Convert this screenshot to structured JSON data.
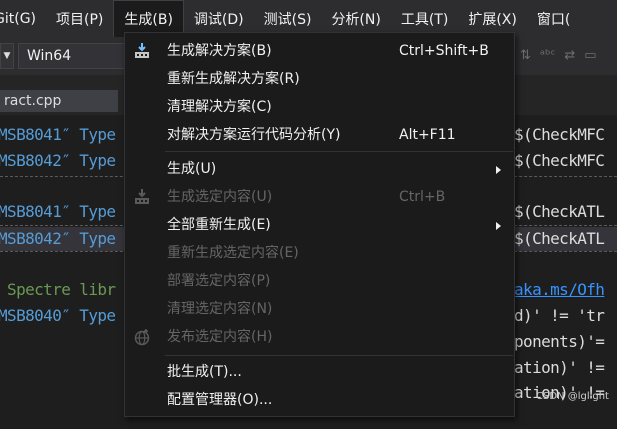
{
  "menubar": {
    "items": [
      {
        "label": "Git(G)"
      },
      {
        "label": "项目(P)"
      },
      {
        "label": "生成(B)"
      },
      {
        "label": "调试(D)"
      },
      {
        "label": "测试(S)"
      },
      {
        "label": "分析(N)"
      },
      {
        "label": "工具(T)"
      },
      {
        "label": "扩展(X)"
      },
      {
        "label": "窗口("
      }
    ]
  },
  "toolbar": {
    "platform": "Win64"
  },
  "editor": {
    "tab_label": "ract.cpp"
  },
  "output": {
    "lines": [
      {
        "left": "MSB8041″ Type",
        "right": "$(CheckMFC"
      },
      {
        "left": "MSB8042″ Type",
        "right": "$(CheckMFC"
      },
      {
        "left": "MSB8041″ Type",
        "right": "$(CheckATL"
      },
      {
        "left": "MSB8042″ Type",
        "right": "$(CheckATL"
      },
      {
        "left": " Spectre libr",
        "right": "aka.ms/Ofh"
      },
      {
        "left": "MSB8040″ Type",
        "right": "d)' != 'tr"
      },
      {
        "left": "",
        "right": "ponents)'="
      },
      {
        "left": "",
        "right": "ation)' !="
      },
      {
        "left": "",
        "right": "ation)' !="
      }
    ]
  },
  "build_menu": {
    "items": [
      {
        "label": "生成解决方案(B)",
        "shortcut": "Ctrl+Shift+B",
        "icon": "build-solution-icon"
      },
      {
        "label": "重新生成解决方案(R)",
        "shortcut": ""
      },
      {
        "label": "清理解决方案(C)",
        "shortcut": ""
      },
      {
        "label": "对解决方案运行代码分析(Y)",
        "shortcut": "Alt+F11"
      },
      {
        "label": "生成(U)",
        "shortcut": ""
      },
      {
        "label": "生成选定内容(U)",
        "shortcut": "Ctrl+B",
        "icon": "build-selection-icon"
      },
      {
        "label": "全部重新生成(E)",
        "shortcut": ""
      },
      {
        "label": "重新生成选定内容(E)",
        "shortcut": ""
      },
      {
        "label": "部署选定内容(P)",
        "shortcut": ""
      },
      {
        "label": "清理选定内容(N)",
        "shortcut": ""
      },
      {
        "label": "发布选定内容(H)",
        "shortcut": "",
        "icon": "publish-globe-icon"
      },
      {
        "label": "批生成(T)...",
        "shortcut": ""
      },
      {
        "label": "配置管理器(O)...",
        "shortcut": ""
      }
    ]
  },
  "watermark": "CSDN @lglight",
  "colors": {
    "menubar_bg": "#2d2d30",
    "menu_bg": "#1b1b1c",
    "editor_bg": "#1e1e1e",
    "disabled_text": "#656565",
    "comment_green": "#6a9955",
    "type_blue": "#569cd6"
  }
}
